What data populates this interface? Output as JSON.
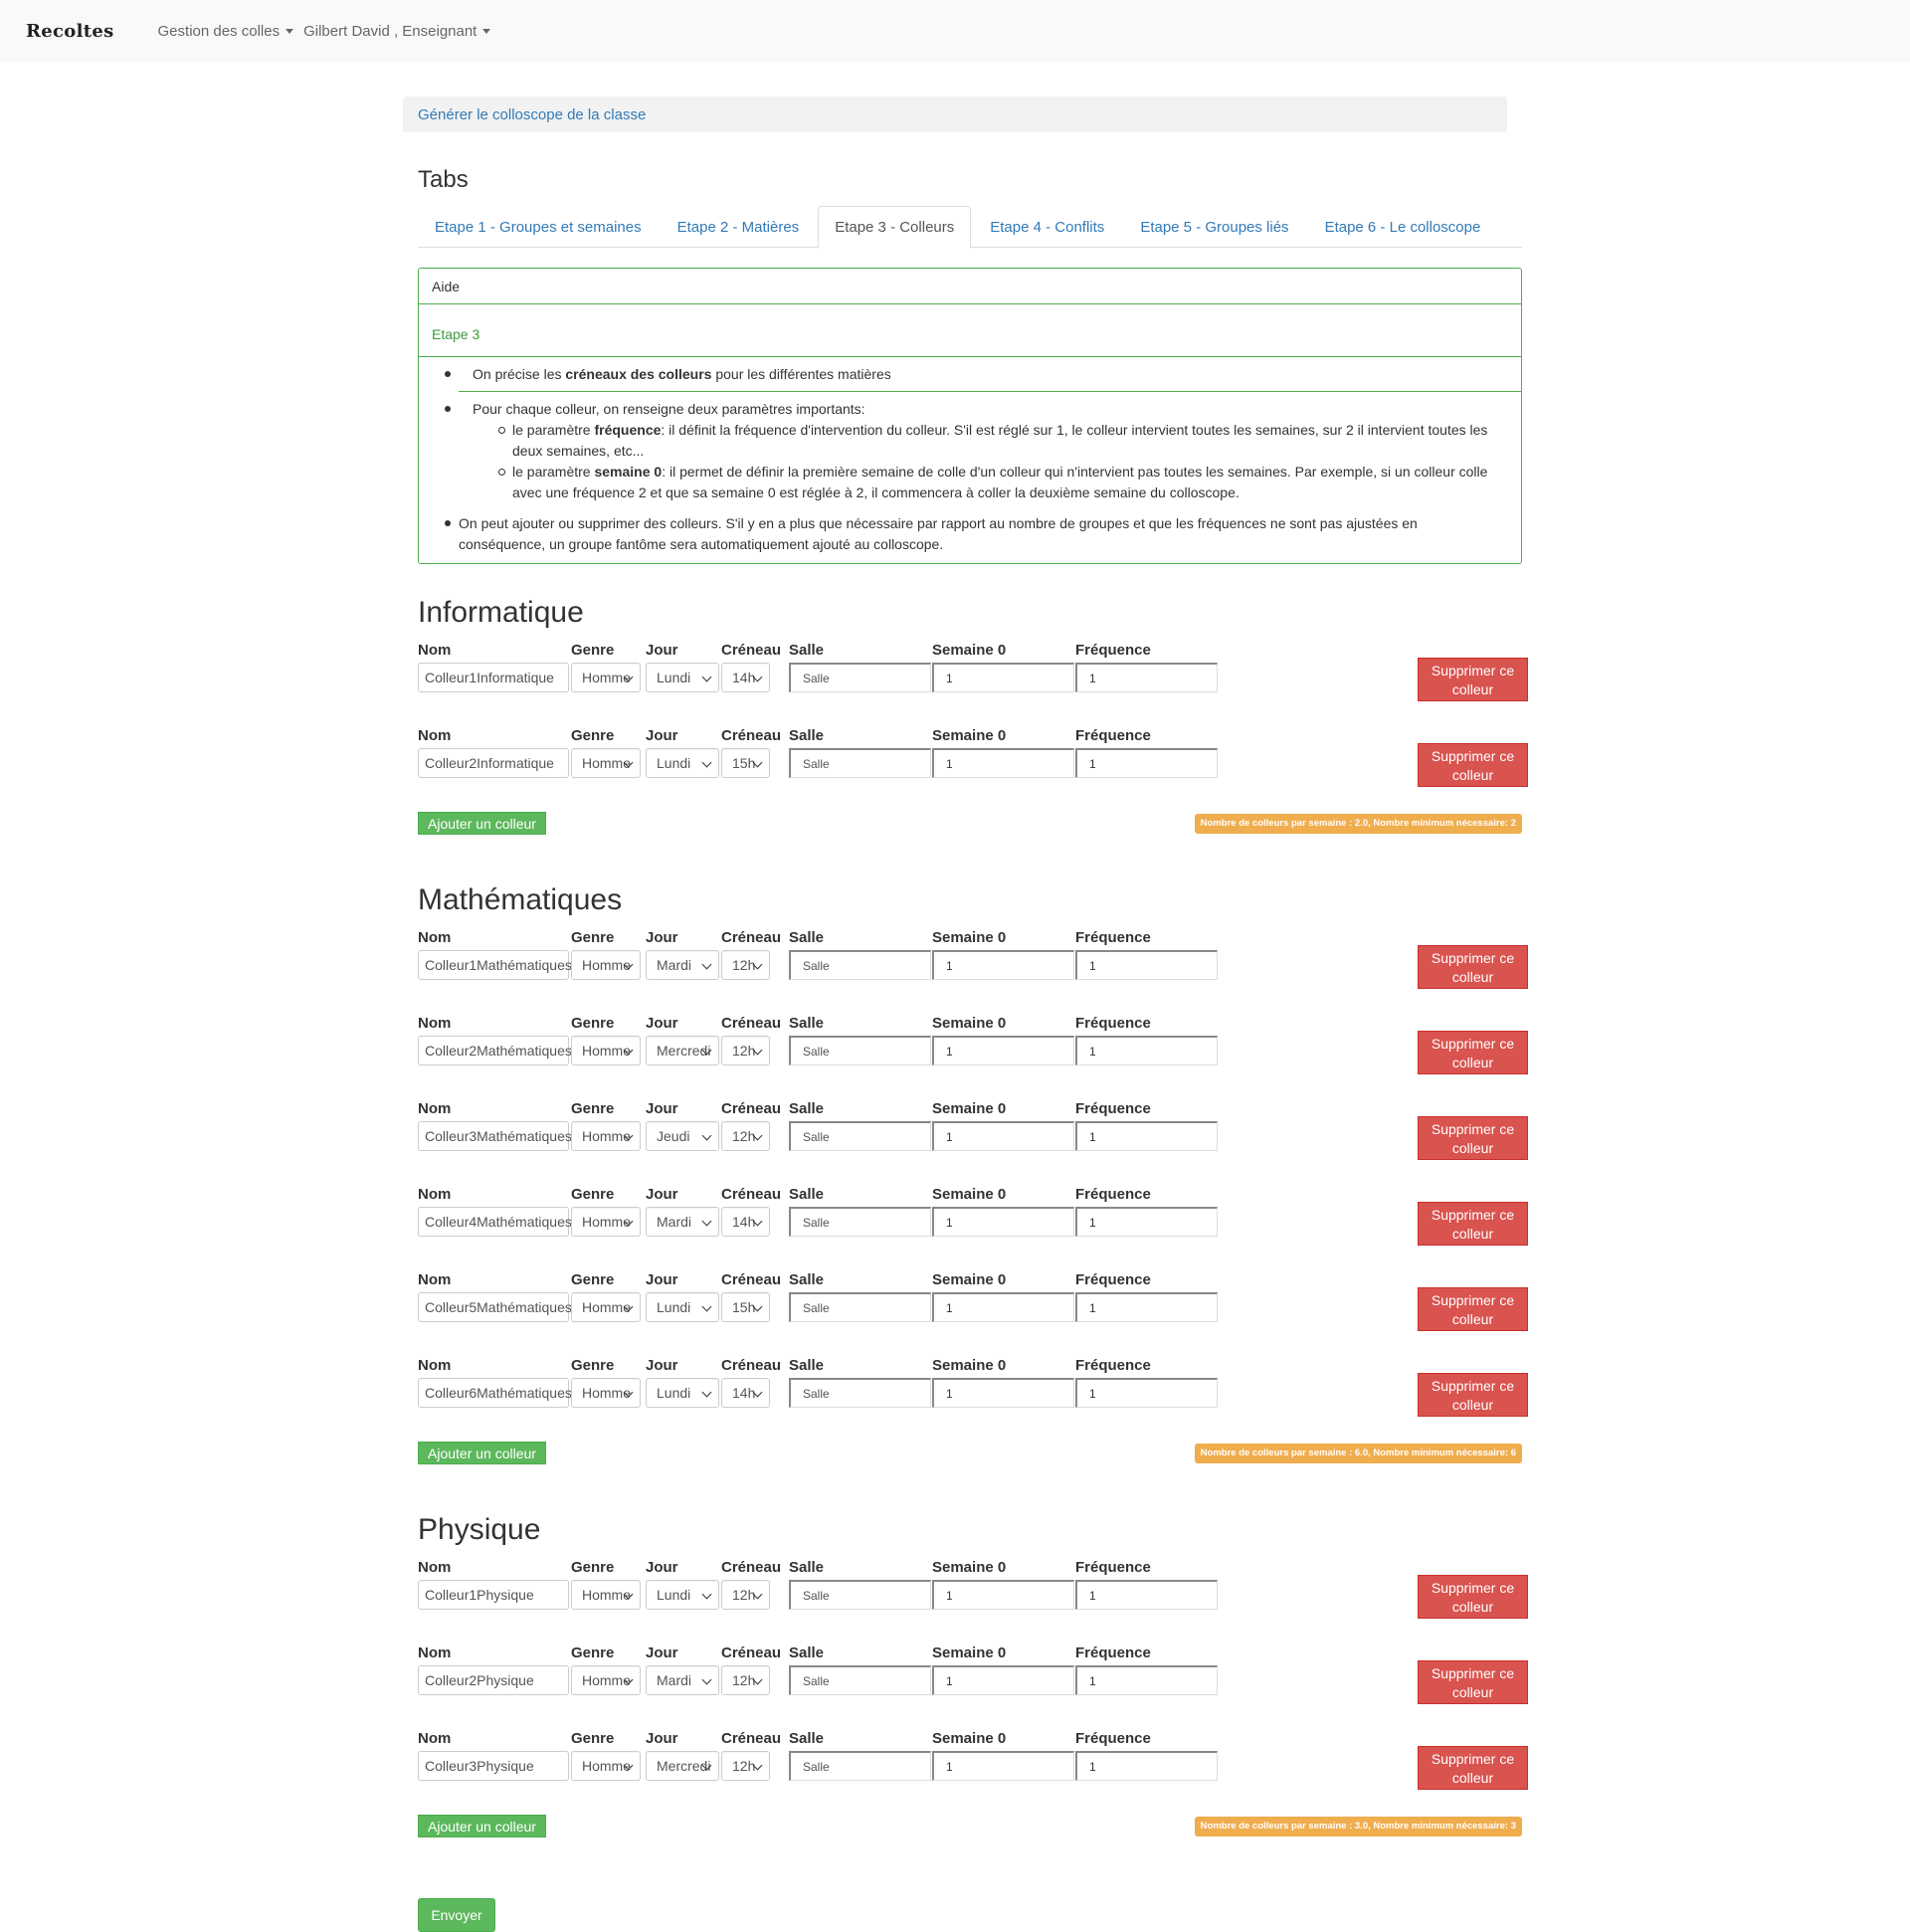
{
  "navbar": {
    "brand": "Recoltes",
    "menu1": "Gestion des colles",
    "menu2": "Gilbert David , Enseignant"
  },
  "generate_link": "Générer le colloscope de la classe",
  "tabs_title": "Tabs",
  "tabs": [
    {
      "label": "Etape 1 - Groupes et semaines",
      "active": false
    },
    {
      "label": "Etape 2 - Matières",
      "active": false
    },
    {
      "label": "Etape 3 - Colleurs",
      "active": true
    },
    {
      "label": "Etape 4 - Conflits",
      "active": false
    },
    {
      "label": "Etape 5 - Groupes liés",
      "active": false
    },
    {
      "label": "Etape 6 - Le colloscope",
      "active": false
    }
  ],
  "help": {
    "heading": "Aide",
    "etape": "Etape 3",
    "item1_pre": "On précise les ",
    "item1_bold": "créneaux des colleurs",
    "item1_post": " pour les différentes matières",
    "item2": "Pour chaque colleur, on renseigne deux paramètres importants:",
    "sub1_pre": "le paramètre ",
    "sub1_bold": "fréquence",
    "sub1_post": ": il définit la fréquence d'intervention du colleur. S'il est réglé sur 1, le colleur intervient toutes les semaines, sur 2 il intervient toutes les deux semaines, etc...",
    "sub2_pre": "le paramètre ",
    "sub2_bold": "semaine 0",
    "sub2_post": ": il permet de définir la première semaine de colle d'un colleur qui n'intervient pas toutes les semaines. Par exemple, si un colleur colle avec une fréquence 2 et que sa semaine 0 est réglée à 2, il commencera à coller la deuxième semaine du colloscope.",
    "item3": "On peut ajouter ou supprimer des colleurs. S'il y en a plus que nécessaire par rapport au nombre de groupes et que les fréquences ne sont pas ajustées en conséquence, un groupe fantôme sera automatiquement ajouté au colloscope."
  },
  "labels": {
    "nom": "Nom",
    "genre": "Genre",
    "jour": "Jour",
    "creneau": "Créneau",
    "salle": "Salle",
    "semaine0": "Semaine 0",
    "frequence": "Fréquence",
    "delete": "Supprimer ce colleur",
    "add": "Ajouter un colleur",
    "salle_placeholder": "Salle"
  },
  "subjects": [
    {
      "name": "Informatique",
      "badge": "Nombre de colleurs par semaine : 2.0, Nombre minimum nécessaire: 2",
      "colleurs": [
        {
          "nom": "Colleur1Informatique",
          "genre": "Homme",
          "jour": "Lundi",
          "creneau": "14h",
          "salle": "Salle",
          "semaine0": "1",
          "frequence": "1"
        },
        {
          "nom": "Colleur2Informatique",
          "genre": "Homme",
          "jour": "Lundi",
          "creneau": "15h",
          "salle": "Salle",
          "semaine0": "1",
          "frequence": "1"
        }
      ]
    },
    {
      "name": "Mathématiques",
      "badge": "Nombre de colleurs par semaine : 6.0, Nombre minimum nécessaire: 6",
      "colleurs": [
        {
          "nom": "Colleur1Mathématiques",
          "genre": "Homme",
          "jour": "Mardi",
          "creneau": "12h",
          "salle": "Salle",
          "semaine0": "1",
          "frequence": "1"
        },
        {
          "nom": "Colleur2Mathématiques",
          "genre": "Homme",
          "jour": "Mercredi",
          "creneau": "12h",
          "salle": "Salle",
          "semaine0": "1",
          "frequence": "1"
        },
        {
          "nom": "Colleur3Mathématiques",
          "genre": "Homme",
          "jour": "Jeudi",
          "creneau": "12h",
          "salle": "Salle",
          "semaine0": "1",
          "frequence": "1"
        },
        {
          "nom": "Colleur4Mathématiques",
          "genre": "Homme",
          "jour": "Mardi",
          "creneau": "14h",
          "salle": "Salle",
          "semaine0": "1",
          "frequence": "1"
        },
        {
          "nom": "Colleur5Mathématiques",
          "genre": "Homme",
          "jour": "Lundi",
          "creneau": "15h",
          "salle": "Salle",
          "semaine0": "1",
          "frequence": "1"
        },
        {
          "nom": "Colleur6Mathématiques",
          "genre": "Homme",
          "jour": "Lundi",
          "creneau": "14h",
          "salle": "Salle",
          "semaine0": "1",
          "frequence": "1"
        }
      ]
    },
    {
      "name": "Physique",
      "badge": "Nombre de colleurs par semaine : 3.0, Nombre minimum nécessaire: 3",
      "colleurs": [
        {
          "nom": "Colleur1Physique",
          "genre": "Homme",
          "jour": "Lundi",
          "creneau": "12h",
          "salle": "Salle",
          "semaine0": "1",
          "frequence": "1"
        },
        {
          "nom": "Colleur2Physique",
          "genre": "Homme",
          "jour": "Mardi",
          "creneau": "12h",
          "salle": "Salle",
          "semaine0": "1",
          "frequence": "1"
        },
        {
          "nom": "Colleur3Physique",
          "genre": "Homme",
          "jour": "Mercredi",
          "creneau": "12h",
          "salle": "Salle",
          "semaine0": "1",
          "frequence": "1"
        }
      ]
    }
  ],
  "submit_label": "Envoyer",
  "colors": {
    "accent_link": "#337ab7",
    "success": "#5cb85c",
    "danger": "#d9534f",
    "warning": "#f0ad4e"
  }
}
